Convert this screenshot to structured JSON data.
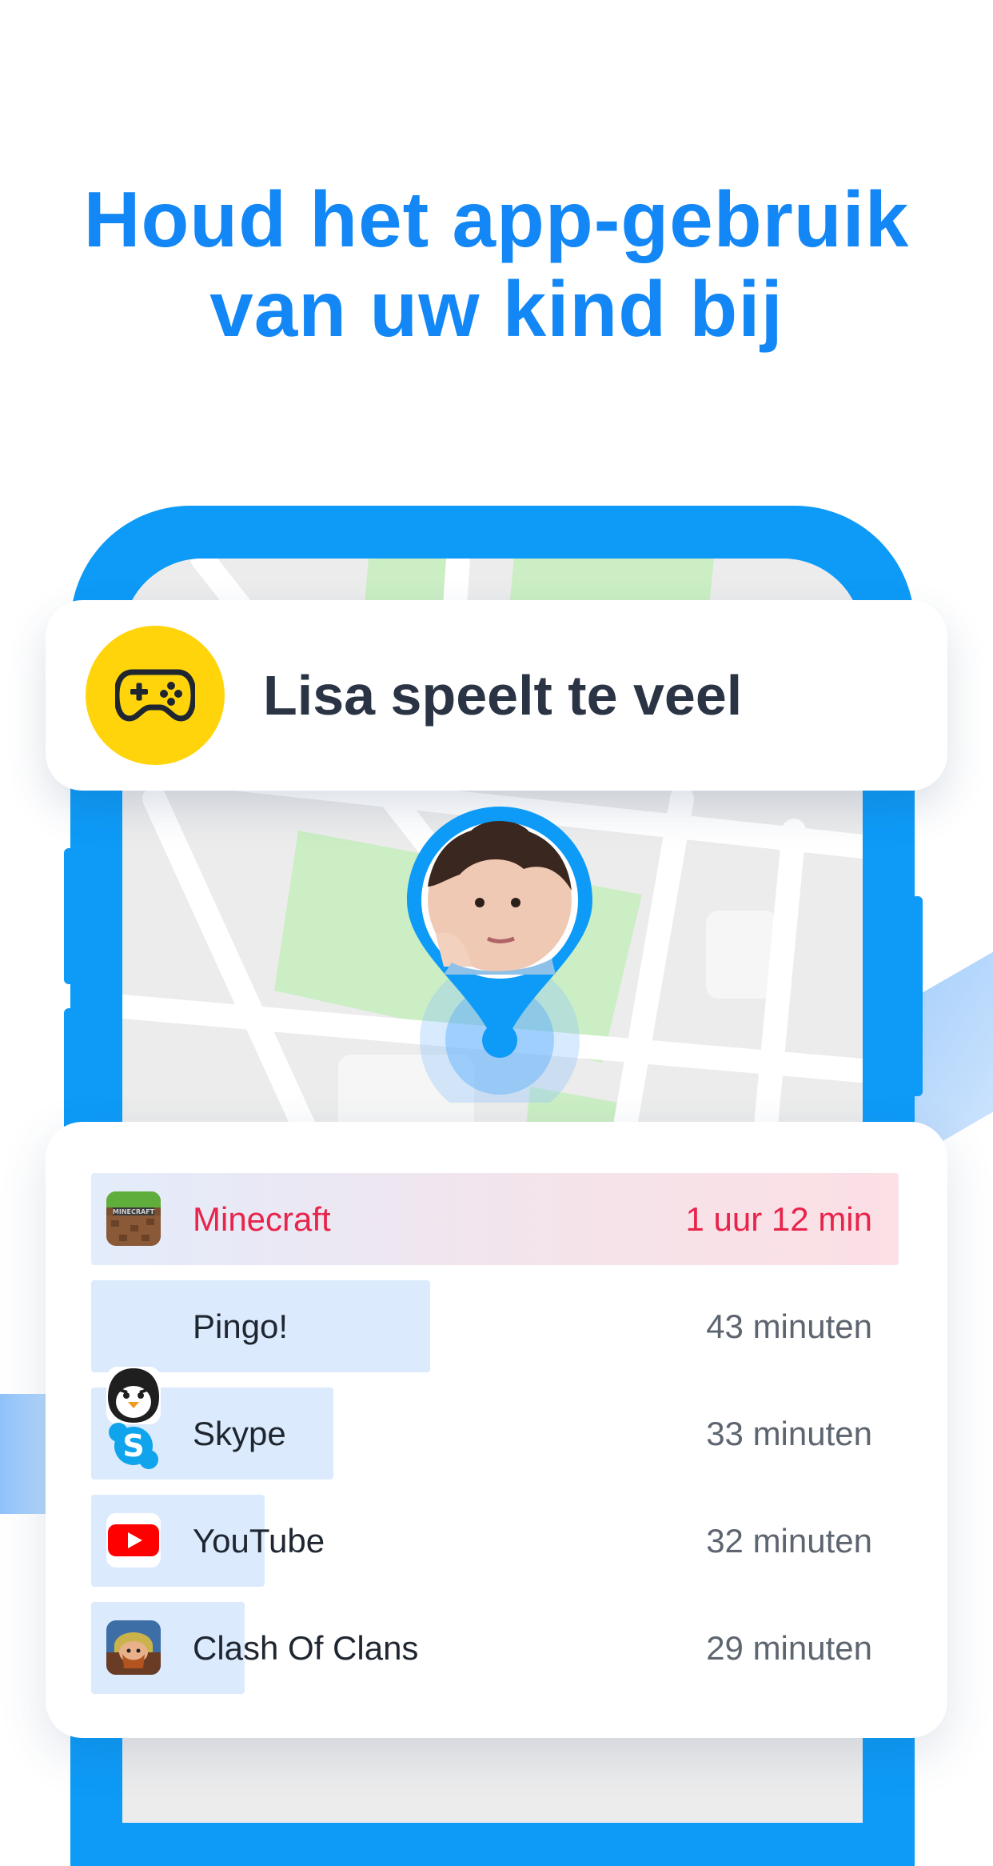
{
  "headline": {
    "line1": "Houd het app-gebruik",
    "line2": "van uw kind bij"
  },
  "notification": {
    "icon": "gamepad-icon",
    "text": "Lisa speelt te veel"
  },
  "apps": [
    {
      "name": "Minecraft",
      "time": "1 uur 12 min",
      "icon": "minecraft-icon",
      "highlighted": true,
      "usage_fraction": 1.0
    },
    {
      "name": "Pingo!",
      "time": "43 minuten",
      "icon": "pingo-penguin-icon",
      "highlighted": false,
      "usage_fraction": 0.42
    },
    {
      "name": "Skype",
      "time": "33 minuten",
      "icon": "skype-icon",
      "highlighted": false,
      "usage_fraction": 0.3
    },
    {
      "name": "YouTube",
      "time": "32 minuten",
      "icon": "youtube-icon",
      "highlighted": false,
      "usage_fraction": 0.215
    },
    {
      "name": "Clash Of Clans",
      "time": "29 minuten",
      "icon": "clash-of-clans-icon",
      "highlighted": false,
      "usage_fraction": 0.19
    }
  ],
  "colors": {
    "accent": "#1287f5",
    "phone": "#0d9bf7",
    "alert": "#e8244b",
    "notification_icon_bg": "#ffd40a"
  }
}
